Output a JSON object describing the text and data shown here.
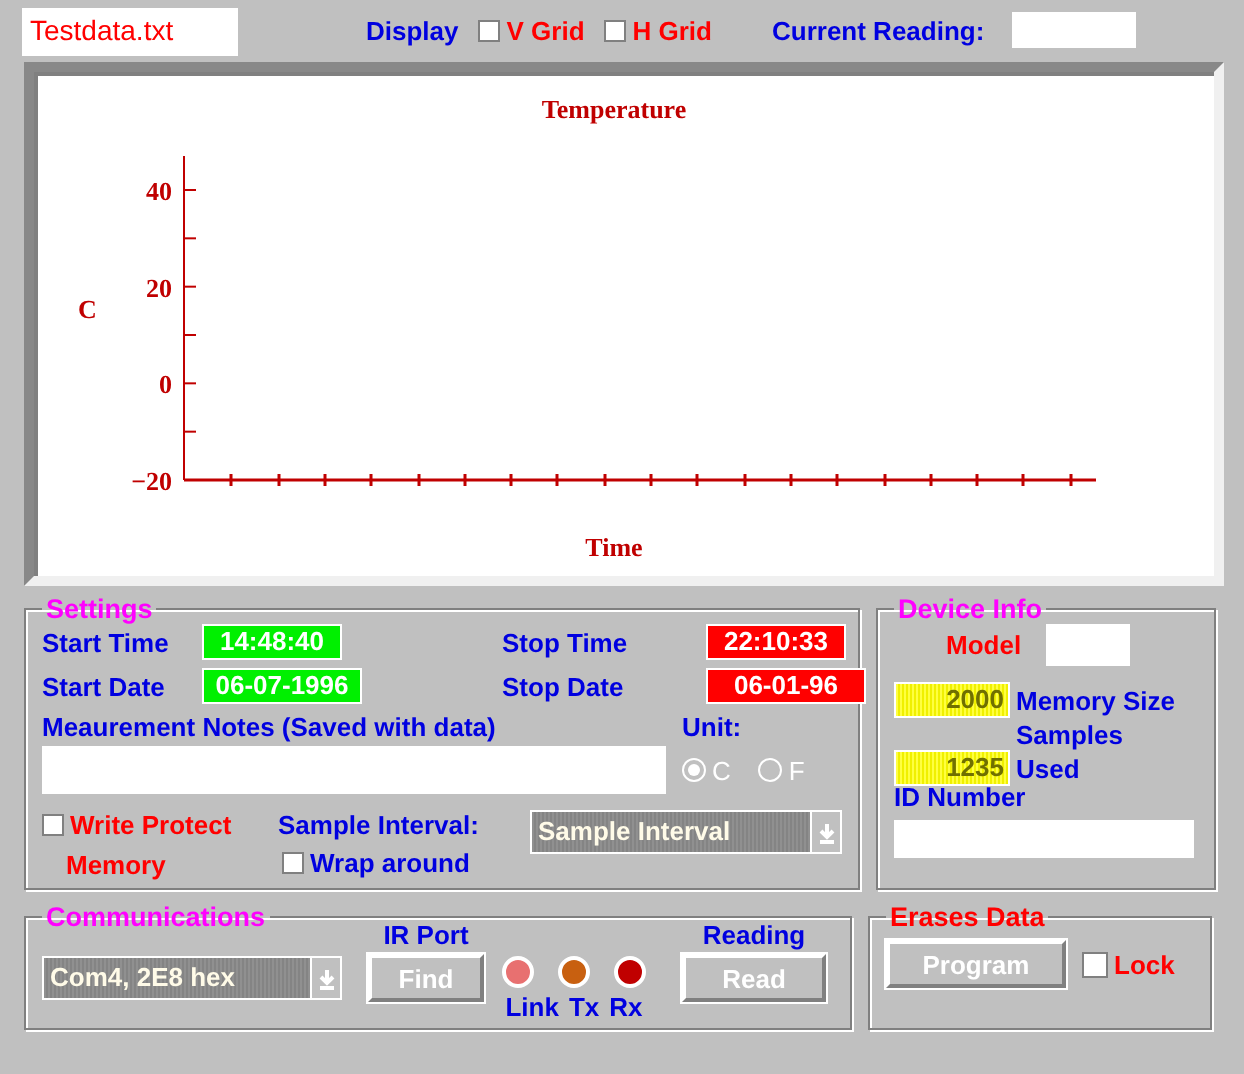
{
  "file_name": "Testdata.txt",
  "display": {
    "label": "Display",
    "options": [
      {
        "label": "V Grid",
        "checked": false
      },
      {
        "label": "H Grid",
        "checked": false
      }
    ]
  },
  "current_reading": {
    "label": "Current Reading:"
  },
  "chart": {
    "title": "Temperature",
    "xlabel": "Time",
    "ylabel": "C",
    "y_tick_labels": [
      "40",
      "20",
      "0",
      "−20"
    ]
  },
  "settings": {
    "title": "Settings",
    "times": [
      {
        "label": "Start Time",
        "value": "14:48:40",
        "kind": "start"
      },
      {
        "label": "Stop Time",
        "value": "22:10:33",
        "kind": "stop"
      },
      {
        "label": "Start Date",
        "value": "06-07-1996",
        "kind": "start"
      },
      {
        "label": "Stop Date",
        "value": "06-01-96",
        "kind": "stop"
      }
    ],
    "notes_label": "Meaurement Notes (Saved with data)",
    "unit": {
      "label": "Unit:",
      "options": [
        {
          "label": "C",
          "selected": true
        },
        {
          "label": "F",
          "selected": false
        }
      ]
    },
    "write_protect": {
      "label": "Write Protect",
      "sublabel": "Memory",
      "checked": false
    },
    "sample_interval": {
      "label": "Sample Interval:",
      "placeholder": "Sample Interval"
    },
    "wrap_around": {
      "label": "Wrap around",
      "checked": false
    }
  },
  "device_info": {
    "title": "Device Info",
    "model_label": "Model",
    "memory_size": {
      "value": "2000",
      "label": "Memory Size"
    },
    "samples_used": {
      "value": "1235",
      "label": "Samples",
      "label2": "Used"
    },
    "id_label": "ID Number"
  },
  "communications": {
    "title": "Communications",
    "port": "Com4, 2E8 hex",
    "ir_label": "IR Port",
    "find": "Find",
    "leds": [
      {
        "label": "Link",
        "color": "#e87070"
      },
      {
        "label": "Tx",
        "color": "#c86010"
      },
      {
        "label": "Rx",
        "color": "#c00000"
      }
    ],
    "reading_label": "Reading",
    "read": "Read"
  },
  "erase": {
    "title": "Erases Data",
    "program": "Program",
    "lock": {
      "label": "Lock",
      "checked": false
    }
  }
}
